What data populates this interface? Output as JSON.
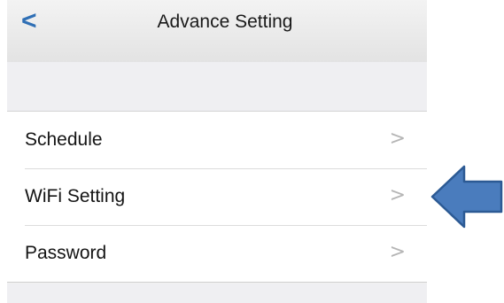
{
  "colors": {
    "accent": "#2f6fb5",
    "arrow_fill": "#4a7cbd",
    "arrow_stroke": "#2c5a94"
  },
  "header": {
    "back_glyph": "<",
    "title": "Advance Setting"
  },
  "menu": {
    "items": [
      {
        "label": "Schedule",
        "chevron": ">"
      },
      {
        "label": "WiFi Setting",
        "chevron": ">"
      },
      {
        "label": "Password",
        "chevron": ">"
      }
    ]
  },
  "annotation": {
    "icon": "left-arrow-icon",
    "points_to": "WiFi Setting"
  }
}
